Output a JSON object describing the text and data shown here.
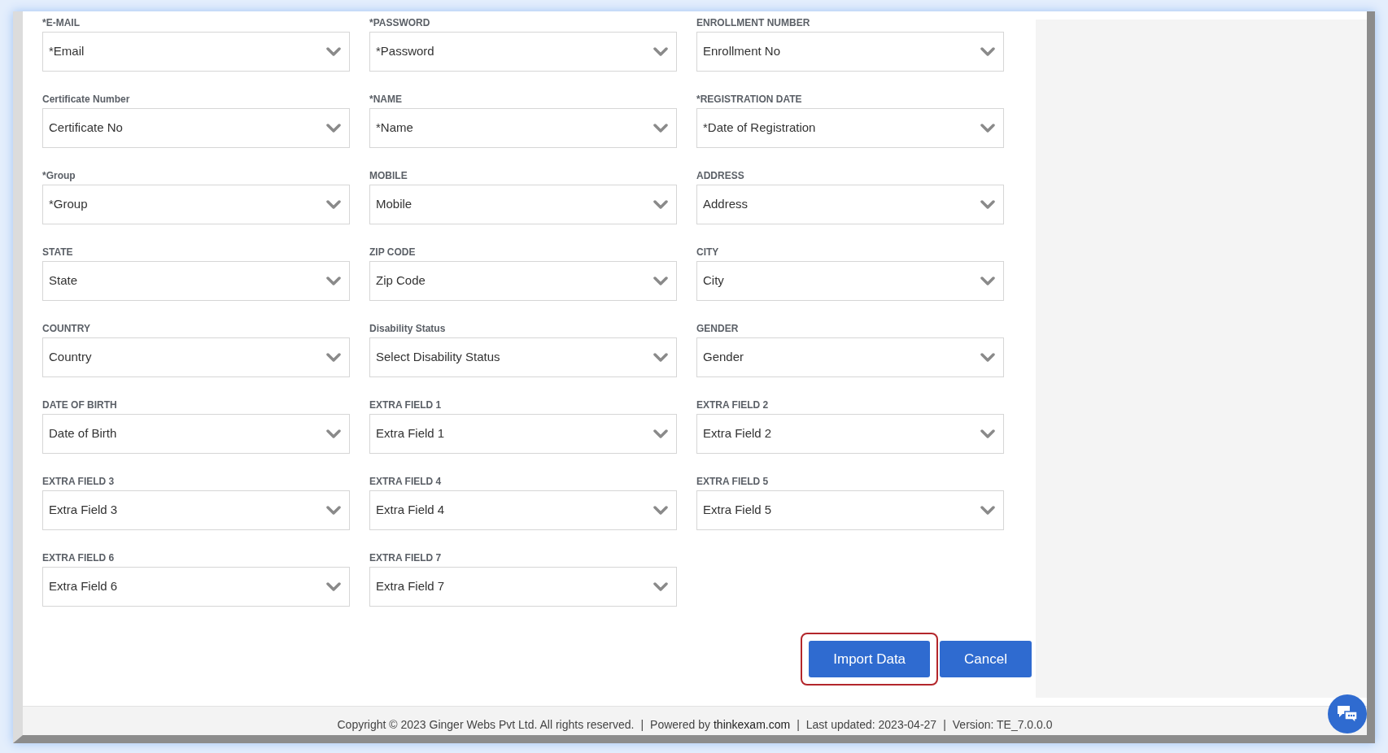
{
  "fields": [
    {
      "label": "*E-MAIL",
      "value": "*Email"
    },
    {
      "label": "*PASSWORD",
      "value": "*Password"
    },
    {
      "label": "ENROLLMENT NUMBER",
      "value": "Enrollment No"
    },
    {
      "label": "Certificate Number",
      "value": "Certificate No"
    },
    {
      "label": "*NAME",
      "value": "*Name"
    },
    {
      "label": "*REGISTRATION DATE",
      "value": "*Date of Registration"
    },
    {
      "label": "*Group",
      "value": "*Group"
    },
    {
      "label": "MOBILE",
      "value": "Mobile"
    },
    {
      "label": "ADDRESS",
      "value": "Address"
    },
    {
      "label": "STATE",
      "value": "State"
    },
    {
      "label": "ZIP CODE",
      "value": "Zip Code"
    },
    {
      "label": "CITY",
      "value": "City"
    },
    {
      "label": "COUNTRY",
      "value": "Country"
    },
    {
      "label": "Disability Status",
      "value": "Select Disability Status"
    },
    {
      "label": "GENDER",
      "value": "Gender"
    },
    {
      "label": "DATE OF BIRTH",
      "value": "Date of Birth"
    },
    {
      "label": "EXTRA FIELD 1",
      "value": "Extra Field 1"
    },
    {
      "label": "EXTRA FIELD 2",
      "value": "Extra Field 2"
    },
    {
      "label": "EXTRA FIELD 3",
      "value": "Extra Field 3"
    },
    {
      "label": "EXTRA FIELD 4",
      "value": "Extra Field 4"
    },
    {
      "label": "EXTRA FIELD 5",
      "value": "Extra Field 5"
    },
    {
      "label": "EXTRA FIELD 6",
      "value": "Extra Field 6"
    },
    {
      "label": "EXTRA FIELD 7",
      "value": "Extra Field 7"
    }
  ],
  "buttons": [
    {
      "label": "Import Data",
      "highlighted": true
    },
    {
      "label": "Cancel",
      "highlighted": false
    }
  ],
  "footer": {
    "copyright": "Copyright © 2023 Ginger Webs Pvt Ltd. All rights reserved.",
    "powered_by": "Powered by",
    "link": "thinkexam.com",
    "last_updated": "Last updated: 2023-04-27",
    "version": "Version: TE_7.0.0.0",
    "separator": "|"
  }
}
